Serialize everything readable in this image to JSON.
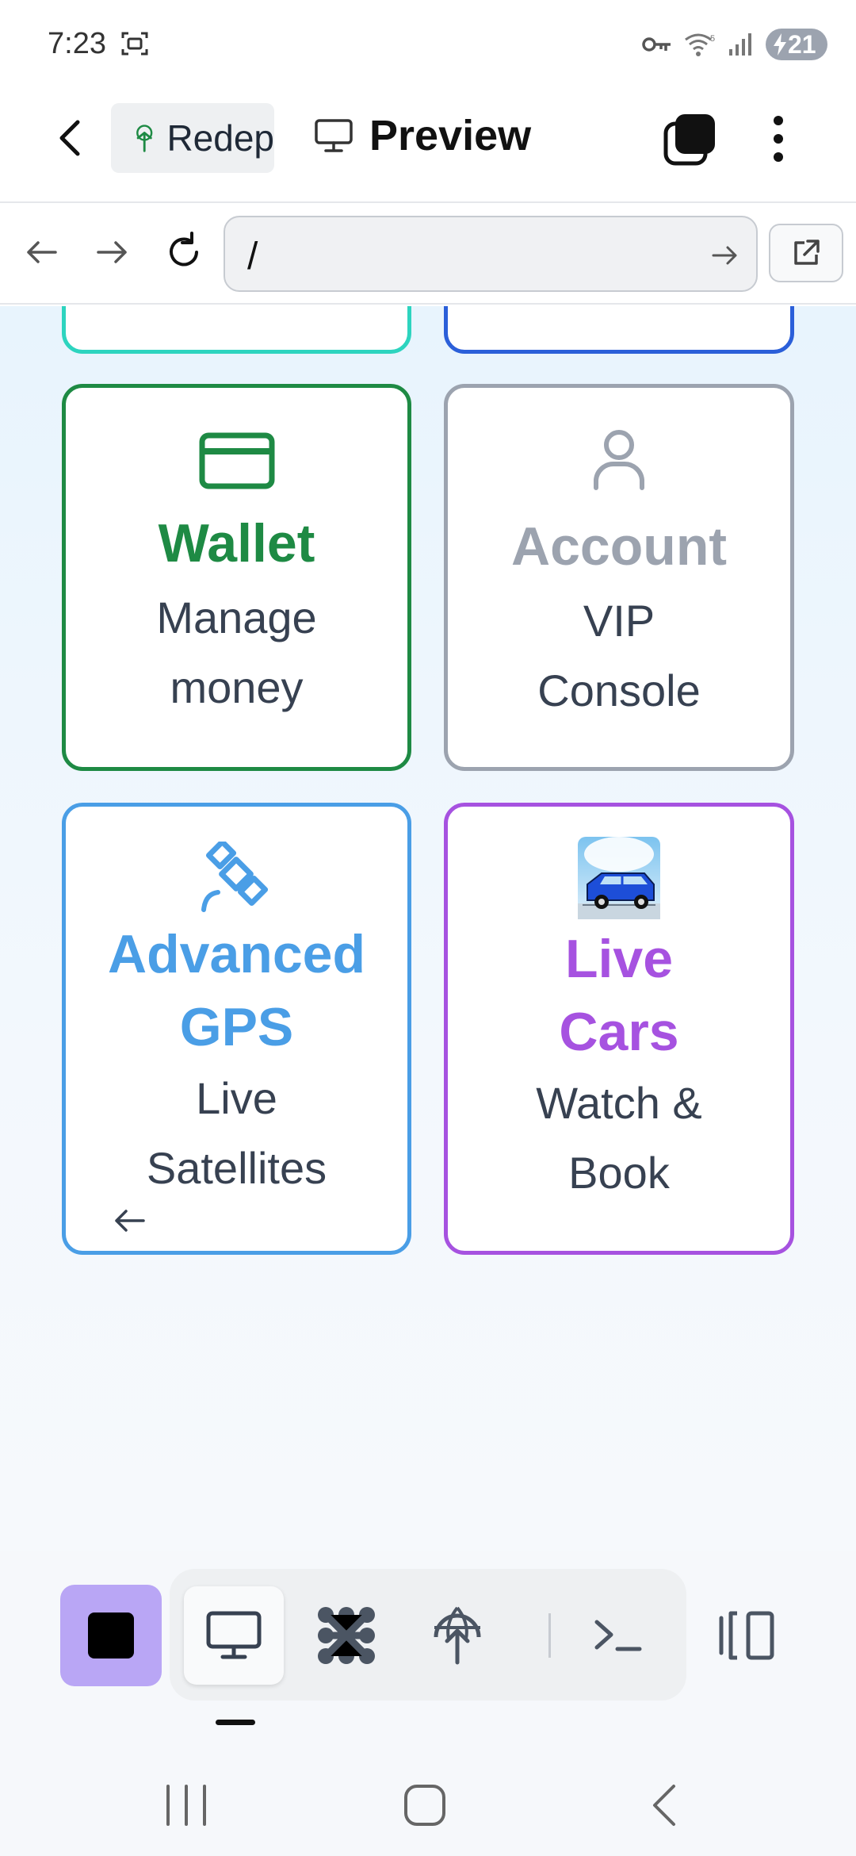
{
  "status_bar": {
    "time": "7:23",
    "battery": "21"
  },
  "header": {
    "project_name": "Redep",
    "tab_label": "Preview"
  },
  "browser": {
    "url": "/"
  },
  "cards": [
    {
      "title": "Wallet",
      "subtitle_line1": "Manage",
      "subtitle_line2": "money",
      "icon": "credit-card-icon",
      "color": "#1e8a44"
    },
    {
      "title": "Account",
      "subtitle_line1": "VIP",
      "subtitle_line2": "Console",
      "icon": "user-icon",
      "color": "#9ca3af"
    },
    {
      "title_line1": "Advanced",
      "title_line2": "GPS",
      "subtitle_line1": "Live",
      "subtitle_line2": "Satellites",
      "icon": "satellite-icon",
      "color": "#4a9ee6"
    },
    {
      "title_line1": "Live",
      "title_line2": "Cars",
      "subtitle_line1": "Watch &",
      "subtitle_line2": "Book",
      "icon": "car-image",
      "color": "#a652e0"
    }
  ],
  "colors": {
    "top_left_card_border": "#2dd4bf",
    "top_right_card_border": "#2b5fd9",
    "stop_button": "#b9a6f5"
  }
}
